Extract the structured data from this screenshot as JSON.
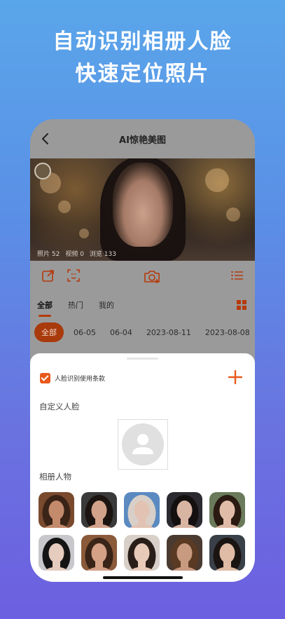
{
  "promo": {
    "line1": "自动识别相册人脸",
    "line2": "快速定位照片"
  },
  "nav": {
    "title": "AI惊艳美图",
    "back_icon": "chevron-left-icon"
  },
  "hero": {
    "stats": [
      "照片 52",
      "视频 0",
      "浏览 133"
    ]
  },
  "toolbar": {
    "icons": [
      "share-icon",
      "face-scan-icon",
      "camera-add-icon",
      "list-icon"
    ]
  },
  "tabs": {
    "items": [
      "全部",
      "热门",
      "我的"
    ],
    "active": 0
  },
  "dates": {
    "items": [
      "全部",
      "06-05",
      "06-04",
      "2023-08-11",
      "2023-08-08"
    ],
    "active": 0
  },
  "sheet": {
    "terms_label": "人脸识别使用条款",
    "terms_checked": true,
    "custom_face_title": "自定义人脸",
    "album_people_title": "相册人物"
  },
  "colors": {
    "accent": "#e8591a",
    "accent_dim": "#a83a0c",
    "overlay": "#9a9a9a"
  },
  "album_faces": [
    {
      "tone": "#c48a6c",
      "hair": "#3a2418",
      "bg": "#7a4a2e"
    },
    {
      "tone": "#d2a28a",
      "hair": "#1c1410",
      "bg": "#3a3a3a"
    },
    {
      "tone": "#e2c2b2",
      "hair": "#d8d0c8",
      "bg": "#5a8ac0"
    },
    {
      "tone": "#d8b4a2",
      "hair": "#141010",
      "bg": "#2a2a30"
    },
    {
      "tone": "#e0bca8",
      "hair": "#2a1a12",
      "bg": "#6a7a5a"
    },
    {
      "tone": "#e6ccbe",
      "hair": "#141414",
      "bg": "#c8c8cc"
    },
    {
      "tone": "#d4a086",
      "hair": "#3a2418",
      "bg": "#8a5a3a"
    },
    {
      "tone": "#e8cab8",
      "hair": "#2a1e18",
      "bg": "#d8d0c8"
    },
    {
      "tone": "#c89a80",
      "hair": "#5a3a22",
      "bg": "#4a3a30"
    },
    {
      "tone": "#e0bca6",
      "hair": "#1a1412",
      "bg": "#3a4048"
    }
  ]
}
